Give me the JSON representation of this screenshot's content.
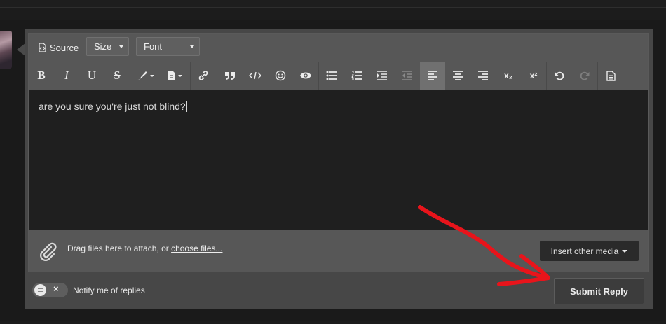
{
  "toolbar": {
    "source_label": "Source",
    "size_label": "Size",
    "font_label": "Font",
    "format_icons": [
      "bold-icon",
      "italic-icon",
      "underline-icon",
      "strikethrough-icon",
      "text-color-icon",
      "paragraph-format-icon",
      "link-icon",
      "quote-icon",
      "code-icon",
      "emoji-icon",
      "preview-icon",
      "bulleted-list-icon",
      "numbered-list-icon",
      "indent-icon",
      "outdent-icon",
      "align-left-icon",
      "align-center-icon",
      "align-right-icon",
      "subscript-icon",
      "superscript-icon",
      "undo-icon",
      "redo-icon",
      "drafts-icon"
    ],
    "glyphs": {
      "bold": "B",
      "italic": "I",
      "underline": "U",
      "strike": "S",
      "subscript": "x₂",
      "superscript": "x²"
    },
    "active_item": "align-left-icon"
  },
  "editor": {
    "content": "are you sure you're just not blind?"
  },
  "attach": {
    "prefix": "Drag files here to attach, or ",
    "link": "choose files...",
    "insert_media_label": "Insert other media"
  },
  "notify": {
    "label": "Notify me of replies",
    "enabled": false
  },
  "submit": {
    "label": "Submit Reply"
  },
  "colors": {
    "annotation_arrow": "#e8141b",
    "toolbar_bg": "#575757",
    "content_bg": "#1f1f1f"
  }
}
